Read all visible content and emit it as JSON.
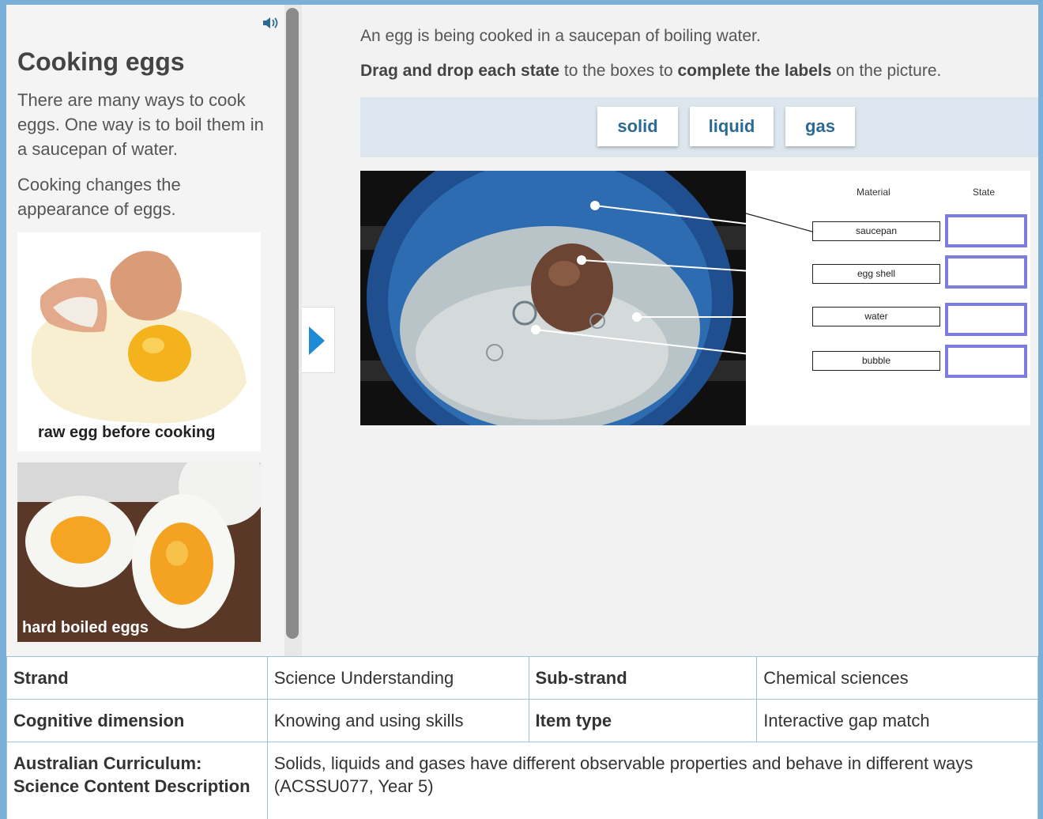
{
  "sidebar": {
    "title": "Cooking eggs",
    "paragraphs": [
      "There are many ways to cook eggs. One way is to boil them in a saucepan of water.",
      "Cooking changes the appearance of eggs."
    ],
    "images": [
      {
        "caption": "raw egg before cooking"
      },
      {
        "caption": "hard boiled eggs"
      }
    ],
    "icons": [
      "speaker-icon"
    ]
  },
  "question": {
    "intro": "An egg is being cooked in a saucepan of boiling water.",
    "instruction": {
      "b1": "Drag and drop each state",
      "t1": " to the boxes to ",
      "b2": "complete the labels",
      "t2": " on the picture."
    },
    "choices": [
      "solid",
      "liquid",
      "gas"
    ],
    "diagram": {
      "col_material": "Material",
      "col_state": "State",
      "materials": [
        "saucepan",
        "egg shell",
        "water",
        "bubble"
      ]
    }
  },
  "table": {
    "rows": [
      {
        "k1": "Strand",
        "v1": "Science Understanding",
        "k2": "Sub-strand",
        "v2": "Chemical sciences"
      },
      {
        "k1": "Cognitive dimension",
        "v1": "Knowing and using skills",
        "k2": "Item type",
        "v2": "Interactive gap match"
      },
      {
        "k1": "Australian Curriculum: Science Content Description",
        "v1": "Solids, liquids and gases have different observable properties and behave in different ways (ACSSU077, Year 5)"
      }
    ]
  },
  "colors": {
    "frame": "#7ab0d8",
    "chip_text": "#2b6a92",
    "drop_border": "#7b7be0",
    "arrow": "#1e8ad6"
  }
}
